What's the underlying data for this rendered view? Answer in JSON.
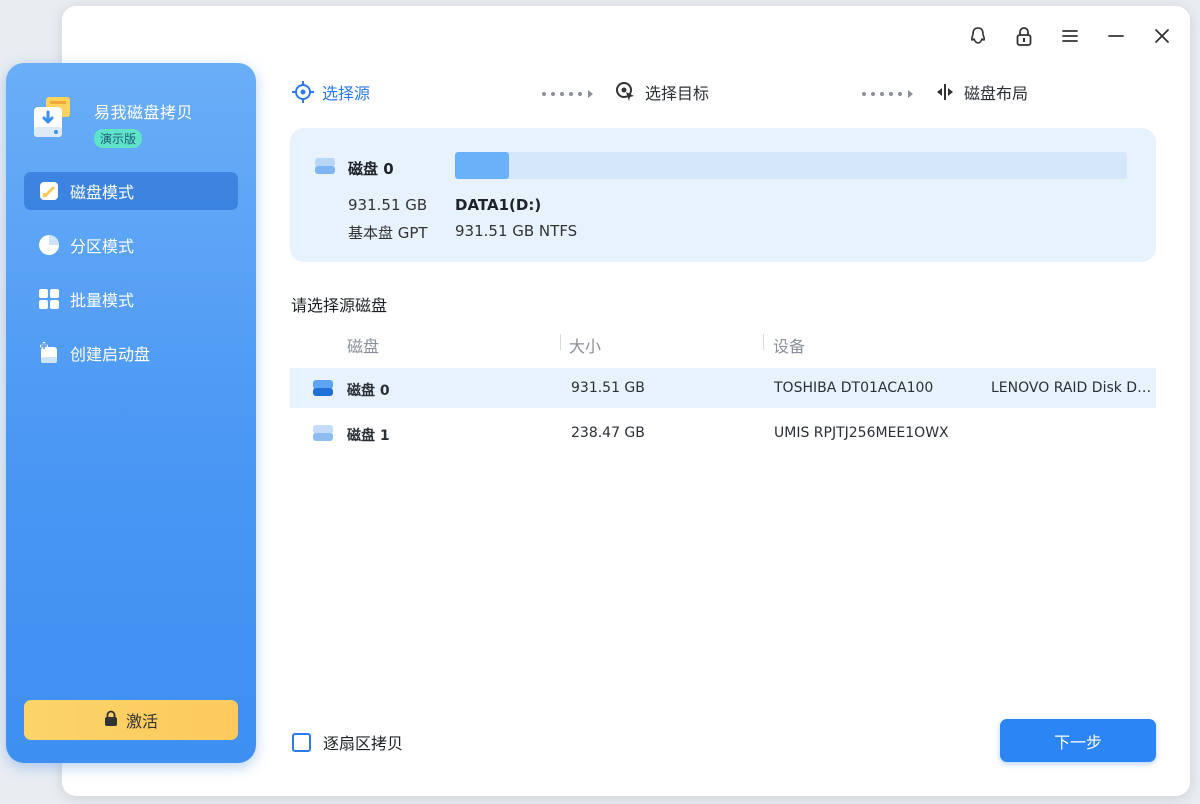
{
  "app": {
    "name": "易我磁盘拷贝",
    "badge": "演示版"
  },
  "sidebar": {
    "items": [
      {
        "label": "磁盘模式",
        "icon": "disk-mode-icon",
        "active": true
      },
      {
        "label": "分区模式",
        "icon": "pie-chart-icon",
        "active": false
      },
      {
        "label": "批量模式",
        "icon": "grid-icon",
        "active": false
      },
      {
        "label": "创建启动盘",
        "icon": "bootable-disk-icon",
        "active": false
      }
    ],
    "activate_label": "激活"
  },
  "titlebar": {
    "icons": [
      "feedback-icon",
      "lock-icon",
      "menu-icon",
      "minimize-icon",
      "close-icon"
    ]
  },
  "steps": [
    {
      "label": "选择源",
      "icon": "crosshair-icon",
      "active": true
    },
    {
      "label": "选择目标",
      "icon": "target-icon",
      "active": false
    },
    {
      "label": "磁盘布局",
      "icon": "layout-icon",
      "active": false
    }
  ],
  "selected_disk": {
    "name": "磁盘 0",
    "size": "931.51 GB",
    "type": "基本盘 GPT",
    "partition_name": "DATA1(D:)",
    "partition_info": "931.51 GB NTFS",
    "partition_fill_percent": 8
  },
  "source_section_title": "请选择源磁盘",
  "table": {
    "columns": [
      "磁盘",
      "大小",
      "设备"
    ],
    "rows": [
      {
        "name": "磁盘 0",
        "size": "931.51 GB",
        "device": "TOSHIBA DT01ACA100",
        "device2": "LENOVO RAID Disk Device",
        "selected": true
      },
      {
        "name": "磁盘 1",
        "size": "238.47 GB",
        "device": "UMIS RPJTJ256MEE1OWX",
        "device2": "",
        "selected": false
      }
    ]
  },
  "footer": {
    "sector_copy_label": "逐扇区拷贝",
    "next_label": "下一步"
  },
  "colors": {
    "accent": "#2b7bf0",
    "sidebar": "#4a97f4",
    "activate": "#fbd46b",
    "selection": "#e7f2fd"
  }
}
